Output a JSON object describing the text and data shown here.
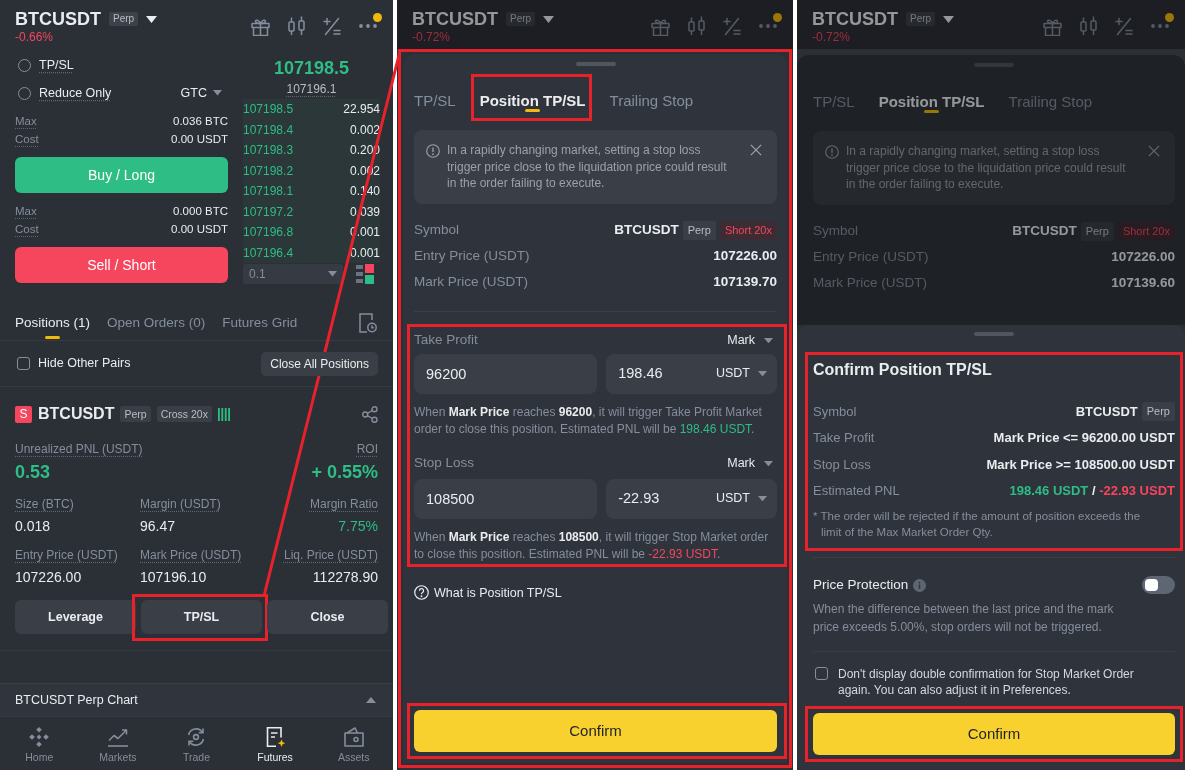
{
  "trade_screen": {
    "header": {
      "symbol": "BTCUSDT",
      "tag": "Perp",
      "change": "-0.66%",
      "falling": true,
      "dimmed": false
    },
    "order_form": {
      "options": [
        {
          "label": "TP/SL",
          "checked": false
        },
        {
          "label": "Reduce Only",
          "checked": false
        }
      ],
      "time_in_force": "GTC",
      "buy_stats": [
        {
          "label": "Max",
          "value": "0.036 BTC"
        },
        {
          "label": "Cost",
          "value": "0.00 USDT"
        }
      ],
      "buy_button": "Buy / Long",
      "sell_stats": [
        {
          "label": "Max",
          "value": "0.000 BTC"
        },
        {
          "label": "Cost",
          "value": "0.00 USDT"
        }
      ],
      "sell_button": "Sell / Short"
    },
    "order_book": {
      "last_price": "107198.5",
      "mark_price": "107196.1",
      "rows": [
        {
          "price": "107198.5",
          "amount": "22.954"
        },
        {
          "price": "107198.4",
          "amount": "0.002"
        },
        {
          "price": "107198.3",
          "amount": "0.200"
        },
        {
          "price": "107198.2",
          "amount": "0.002"
        },
        {
          "price": "107198.1",
          "amount": "0.140"
        },
        {
          "price": "107197.2",
          "amount": "0.039"
        },
        {
          "price": "107196.8",
          "amount": "0.001"
        },
        {
          "price": "107196.4",
          "amount": "0.001"
        }
      ],
      "precision": "0.1"
    },
    "tabs": [
      {
        "label": "Positions (1)",
        "selected": true
      },
      {
        "label": "Open Orders (0)",
        "selected": false
      },
      {
        "label": "Futures Grid",
        "selected": false
      }
    ],
    "hide_other_pairs": {
      "label": "Hide Other Pairs",
      "checked": false
    },
    "close_all_button": "Close All Positions",
    "position": {
      "side_badge": "S",
      "short": true,
      "symbol": "BTCUSDT",
      "tags": [
        "Perp",
        "Cross 20x"
      ],
      "pnl": [
        {
          "label": "Unrealized PNL (USDT)",
          "value": "0.53",
          "color": "#2ebd85"
        },
        {
          "label": "ROI",
          "value": "+ 0.55%",
          "color": "#2ebd85"
        }
      ],
      "stats": [
        {
          "label": "Size (BTC)",
          "value": "0.018",
          "color": "#eaecef"
        },
        {
          "label": "Margin (USDT)",
          "value": "96.47",
          "color": "#eaecef"
        },
        {
          "label": "Margin Ratio",
          "value": "7.75%",
          "color": "#2ebd85"
        },
        {
          "label": "Entry Price (USDT)",
          "value": "107226.00",
          "color": "#eaecef"
        },
        {
          "label": "Mark Price (USDT)",
          "value": "107196.10",
          "color": "#eaecef"
        },
        {
          "label": "Liq. Price (USDT)",
          "value": "112278.90",
          "color": "#eaecef"
        }
      ],
      "actions": [
        {
          "label": "Leverage",
          "highlighted": false
        },
        {
          "label": "TP/SL",
          "highlighted": true
        },
        {
          "label": "Close",
          "highlighted": false
        }
      ]
    },
    "chart_bar": "BTCUSDT Perp Chart",
    "nav": [
      {
        "label": "Home",
        "selected": false
      },
      {
        "label": "Markets",
        "selected": false
      },
      {
        "label": "Trade",
        "selected": false
      },
      {
        "label": "Futures",
        "selected": true
      },
      {
        "label": "Assets",
        "selected": false
      }
    ]
  },
  "tpsl_screen": {
    "header": {
      "symbol": "BTCUSDT",
      "tag": "Perp",
      "change": "-0.72%",
      "falling": true,
      "dimmed": true
    },
    "sheet": {
      "highlighted": true,
      "dimmed": false,
      "tabs": [
        {
          "label": "TP/SL",
          "selected": false,
          "highlighted": false
        },
        {
          "label": "Position TP/SL",
          "selected": true,
          "highlighted": true
        },
        {
          "label": "Trailing Stop",
          "selected": false,
          "highlighted": false
        }
      ],
      "notice": "In a rapidly changing market, setting a stop loss trigger price close to the liquidation price could result in the order failing to execute.",
      "symbol": {
        "label": "Symbol",
        "value": "BTCUSDT",
        "tags": [
          {
            "label": "Perp",
            "kind": "neutral"
          },
          {
            "label": "Short 20x",
            "kind": "short"
          }
        ]
      },
      "rows": [
        {
          "label": "Entry Price (USDT)",
          "value": "107226.00"
        },
        {
          "label": "Mark Price (USDT)",
          "value": "107139.70"
        }
      ],
      "orders": {
        "highlighted": true,
        "items": [
          {
            "label": "Take Profit",
            "trigger": "Mark",
            "price": "96200",
            "pnl": "198.46",
            "unit": "USDT",
            "note": "When **Mark Price** reaches **96200**, it will trigger Take Profit Market order to close this position. Estimated PNL will be ",
            "note_pnl": "198.46 USDT",
            "note_end": ".",
            "color": "#2ebd85"
          },
          {
            "label": "Stop Loss",
            "trigger": "Mark",
            "price": "108500",
            "pnl": "-22.93",
            "unit": "USDT",
            "note": "When **Mark Price** reaches **108500**, it will trigger Stop Market order to close this position. Estimated PNL will be ",
            "note_pnl": "-22.93 USDT",
            "note_end": ".",
            "color": "#f6465d"
          }
        ]
      },
      "help_link": "What is Position TP/SL",
      "confirm": {
        "label": "Confirm",
        "highlighted": true
      }
    }
  },
  "confirm_screen": {
    "header": {
      "symbol": "BTCUSDT",
      "tag": "Perp",
      "change": "-0.72%",
      "falling": true,
      "dimmed": true
    },
    "sheet": {
      "dimmed": true,
      "tabs": [
        {
          "label": "TP/SL",
          "selected": false,
          "highlighted": false
        },
        {
          "label": "Position TP/SL",
          "selected": true,
          "highlighted": false
        },
        {
          "label": "Trailing Stop",
          "selected": false,
          "highlighted": false
        }
      ],
      "notice": "In a rapidly changing market, setting a stop loss trigger price close to the liquidation price could result in the order failing to execute.",
      "symbol": {
        "label": "Symbol",
        "value": "BTCUSDT",
        "tags": [
          {
            "label": "Perp",
            "kind": "neutral"
          },
          {
            "label": "Short 20x",
            "kind": "short"
          }
        ]
      },
      "rows": [
        {
          "label": "Entry Price (USDT)",
          "value": "107226.00"
        },
        {
          "label": "Mark Price (USDT)",
          "value": "107139.60"
        }
      ]
    },
    "dialog": {
      "summary": {
        "highlighted": true,
        "title": "Confirm Position TP/SL",
        "symbol": {
          "label": "Symbol",
          "value": "BTCUSDT",
          "tag": "Perp"
        },
        "rows": [
          {
            "label": "Take Profit",
            "value": "Mark Price <= 96200.00 USDT"
          },
          {
            "label": "Stop Loss",
            "value": "Mark Price >= 108500.00 USDT"
          }
        ],
        "pnl": {
          "label": "Estimated PNL",
          "profit": "198.46 USDT",
          "separator": "/",
          "loss": "-22.93 USDT"
        },
        "note": "* The order will be rejected if the amount of position exceeds the limit of the Max Market Order Qty."
      },
      "price_protection": {
        "label": "Price Protection",
        "on": false,
        "description": "When the difference between the last price and the mark price exceeds 5.00%, stop orders will not be triggered."
      },
      "skip_confirm": {
        "label": "Don't display double confirmation for Stop Market Order again. You can also adjust it in Preferences.",
        "checked": false
      },
      "confirm": {
        "label": "Confirm",
        "highlighted": true
      }
    }
  }
}
